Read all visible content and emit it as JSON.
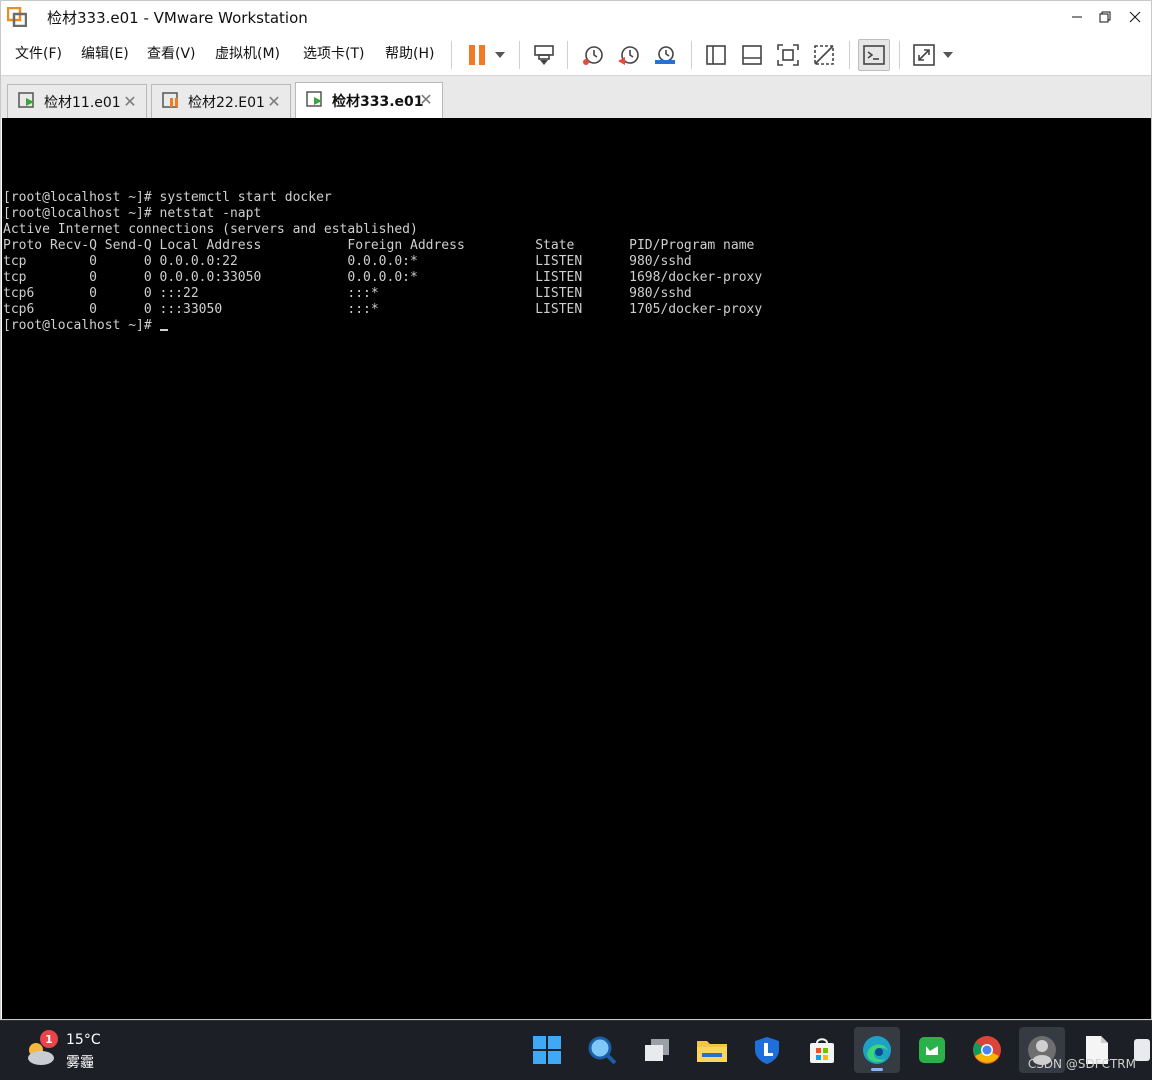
{
  "window": {
    "title": "检材333.e01 - VMware Workstation"
  },
  "menu": [
    {
      "label": "文件(F)"
    },
    {
      "label": "编辑(E)"
    },
    {
      "label": "查看(V)"
    },
    {
      "label": "虚拟机(M)"
    },
    {
      "label": "选项卡(T)"
    },
    {
      "label": "帮助(H)"
    }
  ],
  "toolbar_icons": [
    "pause-icon",
    "dropdown-icon",
    "send-ctrl-alt-del-icon",
    "snapshot-icon",
    "revert-snapshot-icon",
    "snapshot-manager-icon",
    "library-icon",
    "thumbnail-bar-icon",
    "fullscreen-icon",
    "unity-icon",
    "console-view-icon",
    "stretch-icon"
  ],
  "tabs": [
    {
      "label": "检材11.e01",
      "state": "running"
    },
    {
      "label": "检材22.E01",
      "state": "paused"
    },
    {
      "label": "检材333.e01",
      "state": "running",
      "active": true
    }
  ],
  "terminal": {
    "lines": [
      "[root@localhost ~]# systemctl start docker",
      "[root@localhost ~]# netstat -napt",
      "Active Internet connections (servers and established)",
      "Proto Recv-Q Send-Q Local Address           Foreign Address         State       PID/Program name",
      "tcp        0      0 0.0.0.0:22              0.0.0.0:*               LISTEN      980/sshd",
      "tcp        0      0 0.0.0.0:33050           0.0.0.0:*               LISTEN      1698/docker-proxy",
      "tcp6       0      0 :::22                   :::*                    LISTEN      980/sshd",
      "tcp6       0      0 :::33050                :::*                    LISTEN      1705/docker-proxy"
    ],
    "prompt": "[root@localhost ~]# "
  },
  "taskbar": {
    "weather": {
      "temp": "15°C",
      "condition": "雾霾",
      "badge": "1"
    },
    "apps": [
      "windows-start-icon",
      "search-icon",
      "task-view-icon",
      "file-explorer-icon",
      "security-app-icon",
      "store-icon",
      "edge-icon",
      "wechat-icon",
      "chrome-icon",
      "user-app-icon",
      "document-icon"
    ],
    "watermark": "CSDN @SDFCTRM"
  },
  "colors": {
    "console_bg": "#000000",
    "console_fg": "#cfcfcf",
    "taskbar_bg": "#1c1f25",
    "pause_orange": "#f07a26",
    "accent_blue": "#2a6fd1"
  }
}
